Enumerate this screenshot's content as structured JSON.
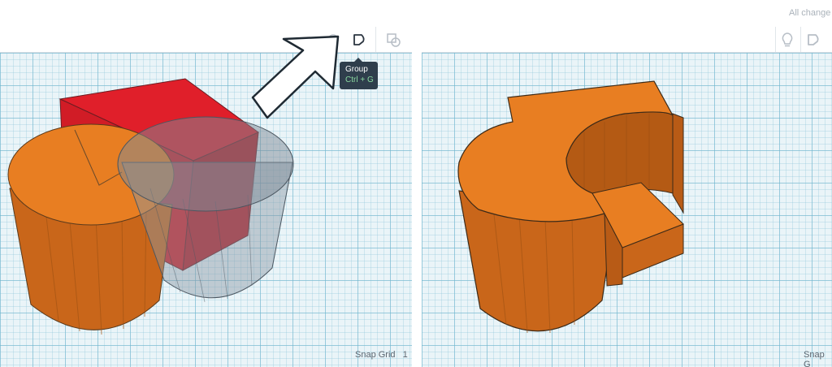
{
  "left_panel": {
    "toolbar": {
      "group_icon": "group-icon",
      "ungroup_icon": "ungroup-icon"
    },
    "tooltip": {
      "title": "Group",
      "shortcut": "Ctrl + G"
    },
    "snap_grid_label": "Snap Grid",
    "snap_grid_value": "1"
  },
  "right_panel": {
    "status_text": "All change",
    "toolbar": {
      "note_icon": "lightbulb-icon",
      "group_icon": "group-icon",
      "ungroup_icon": "ungroup-icon"
    },
    "snap_grid_label": "Snap G"
  },
  "colors": {
    "orange": "#e87e22",
    "red": "#e01f2a",
    "hole_gray": "#8a96a3",
    "tooltip_bg": "#2f3e4c",
    "shortcut_green": "#8ad9a0"
  }
}
